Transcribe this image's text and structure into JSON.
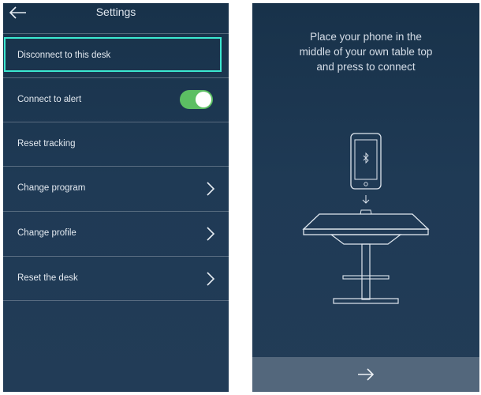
{
  "settings_screen": {
    "header": {
      "title": "Settings",
      "back_icon": "arrow-left-icon"
    },
    "rows": [
      {
        "label": "Disconnect to this desk",
        "selected": true
      },
      {
        "label": "Connect to alert",
        "toggle": true,
        "toggle_on": true
      },
      {
        "label": "Reset tracking"
      },
      {
        "label": "Change program",
        "chevron": true
      },
      {
        "label": "Change profile",
        "chevron": true
      },
      {
        "label": "Reset the desk",
        "chevron": true
      }
    ]
  },
  "connect_screen": {
    "instruction_lines": [
      "Place your phone in the",
      "middle of your own table top",
      "and press to connect"
    ],
    "illustration_icons": [
      "phone-icon",
      "bluetooth-icon",
      "arrow-down-icon",
      "desk-icon"
    ],
    "next_icon": "arrow-right-icon"
  },
  "colors": {
    "background": "#1f3a55",
    "focus_border": "#3be8d0",
    "toggle_on": "#5cbf63",
    "bottom_bar": "#53677c",
    "text": "#e3e9f0"
  }
}
